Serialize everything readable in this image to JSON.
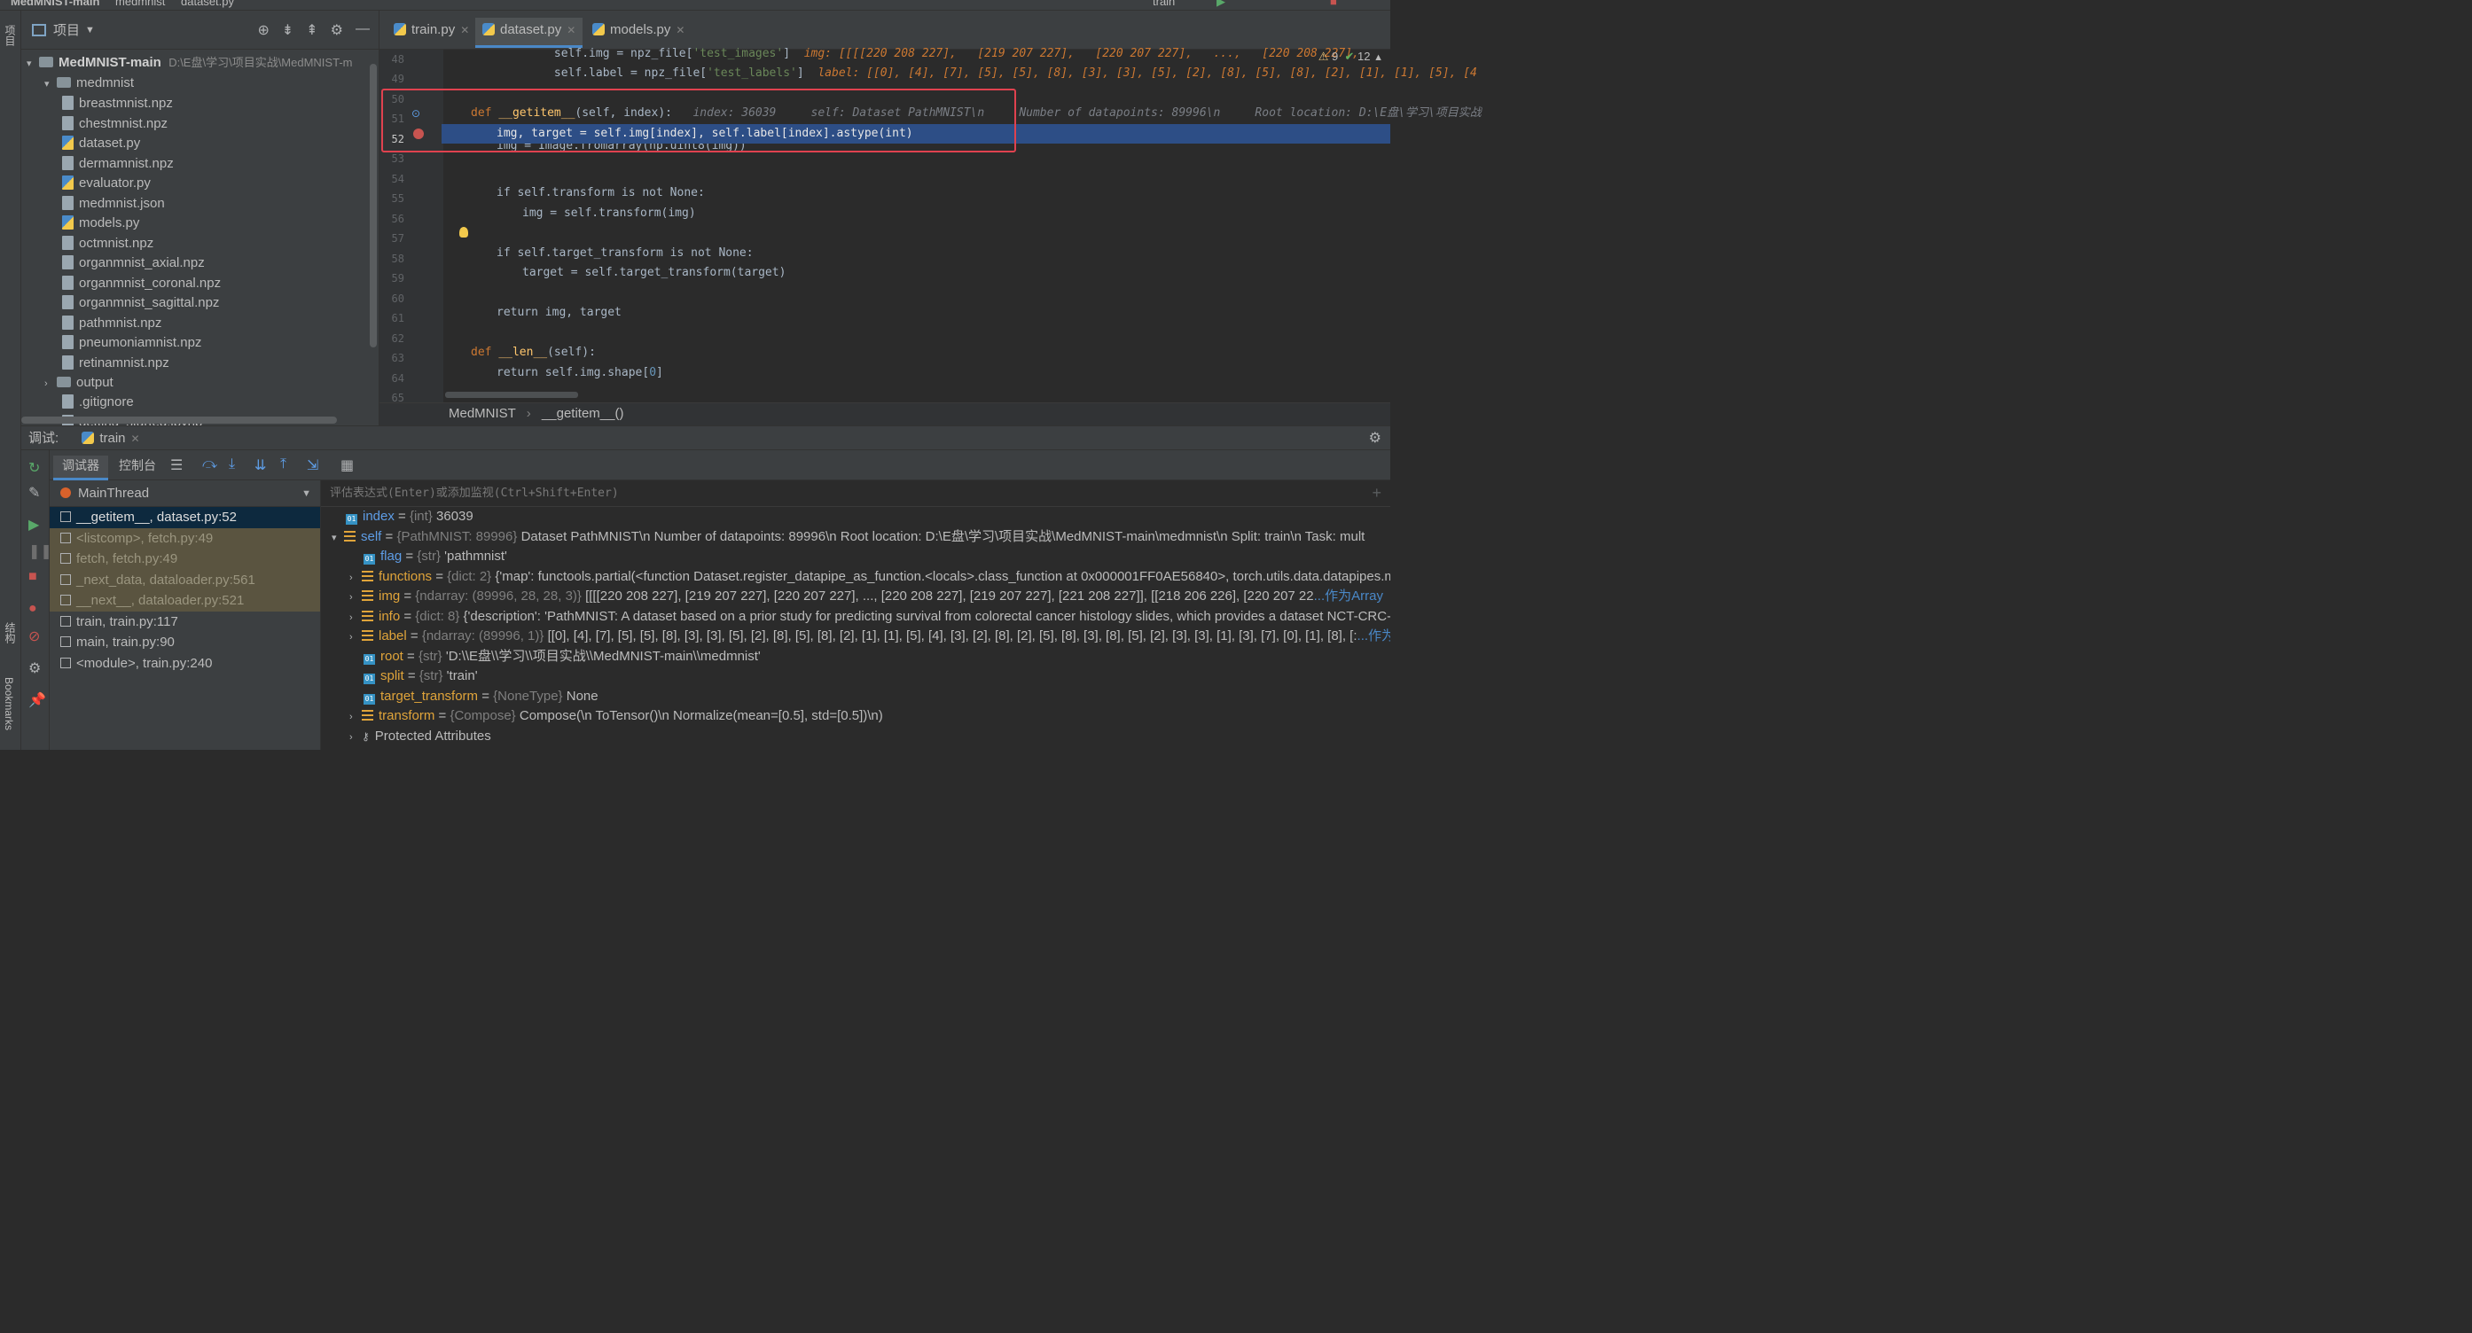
{
  "topbar": {
    "project": "MedMNIST-main",
    "folder": "medmnist",
    "file": "dataset.py",
    "run_config": "train"
  },
  "leftstrip": {
    "project_label": "项目",
    "structure_label": "结构",
    "bookmarks_label": "Bookmarks"
  },
  "project_panel": {
    "title": "项目",
    "root": {
      "name": "MedMNIST-main",
      "path": "D:\\E盘\\学习\\项目实战\\MedMNIST-m"
    },
    "folder": "medmnist",
    "files": [
      "breastmnist.npz",
      "chestmnist.npz",
      "dataset.py",
      "dermamnist.npz",
      "evaluator.py",
      "medmnist.json",
      "models.py",
      "octmnist.npz",
      "organmnist_axial.npz",
      "organmnist_coronal.npz",
      "organmnist_sagittal.npz",
      "pathmnist.npz",
      "pneumoniamnist.npz",
      "retinamnist.npz"
    ],
    "output_folder": "output",
    "root_files": [
      ".gitignore",
      "getting_started.ipynb"
    ]
  },
  "editor": {
    "tabs": [
      {
        "label": "train.py"
      },
      {
        "label": "dataset.py"
      },
      {
        "label": "models.py"
      }
    ],
    "inspections": {
      "warnings": "9",
      "ok": "12"
    },
    "line_numbers": [
      "48",
      "49",
      "50",
      "51",
      "52",
      "53",
      "54",
      "55",
      "56",
      "57",
      "58",
      "59",
      "60",
      "61",
      "62",
      "63",
      "64",
      "65"
    ],
    "code": {
      "l48_pre": "            self.img = npz_file[",
      "l48_str": "'test_images'",
      "l48_post": "]",
      "l48_hint": "img: [[[[220 208 227],   [219 207 227],   [220 207 227],   ...,   [220 208 227],",
      "l49_pre": "            self.label = npz_file[",
      "l49_str": "'test_labels'",
      "l49_post": "]",
      "l49_hint": "label: [[0], [4], [7], [5], [5], [8], [3], [3], [5], [2], [8], [5], [8], [2], [1], [1], [5], [4",
      "l51_def": "def ",
      "l51_name": "__getitem__",
      "l51_args": "(self, index):",
      "l51_hint": "index: 36039     self: Dataset PathMNIST\\n     Number of datapoints: 89996\\n     Root location: D:\\E盘\\学习\\项目实战",
      "l52": "img, target = self.img[index], self.label[index].astype(int)",
      "l53": "img = Image.fromarray(np.uint8(img))",
      "l55": "if self.transform is not None:",
      "l56": "img = self.transform(img)",
      "l58": "if self.target_transform is not None:",
      "l59": "target = self.target_transform(target)",
      "l61": "return img, target",
      "l63_name": "__len__",
      "l63_args": "(self):",
      "l64_pre": "return self.img.shape[",
      "l64_num": "0",
      "l64_post": "]"
    },
    "breadcrumb": {
      "class": "MedMNIST",
      "method": "__getitem__()"
    }
  },
  "debug": {
    "label": "调试:",
    "session": "train",
    "tab_debugger": "调试器",
    "tab_console": "控制台",
    "thread": "MainThread",
    "frames": [
      "__getitem__, dataset.py:52",
      "<listcomp>, fetch.py:49",
      "fetch, fetch.py:49",
      "_next_data, dataloader.py:561",
      "__next__, dataloader.py:521",
      "train, train.py:117",
      "main, train.py:90",
      "<module>, train.py:240"
    ],
    "eval_placeholder": "评估表达式(Enter)或添加监视(Ctrl+Shift+Enter)",
    "vars": {
      "index": {
        "name": "index",
        "type": "{int}",
        "value": "36039"
      },
      "self": {
        "name": "self",
        "type": "{PathMNIST: 89996}",
        "value": "Dataset PathMNIST\\n     Number of datapoints: 89996\\n     Root location: D:\\E盘\\学习\\项目实战\\MedMNIST-main\\medmnist\\n     Split: train\\n     Task: mult"
      },
      "flag": {
        "name": "flag",
        "type": "{str}",
        "value": "'pathmnist'"
      },
      "functions": {
        "name": "functions",
        "type": "{dict: 2}",
        "value": "{'map': functools.partial(<function Dataset.register_datapipe_as_function.<locals>.class_function at 0x000001FF0AE56840>, torch.utils.data.datapipes.map.c"
      },
      "img": {
        "name": "img",
        "type": "{ndarray: (89996, 28, 28, 3)}",
        "value": "[[[[220 208 227],   [219 207 227],   [220 207 227],   ...,   [220 208 227],   [219 207 227],   [221 208 227]],  [[218 206 226],   [220 207 22",
        "more": "...作为Array"
      },
      "info": {
        "name": "info",
        "type": "{dict: 8}",
        "value": "{'description': 'PathMNIST: A dataset based on a prior study for predicting survival from colorectal cancer histology slides, which provides a dataset NCT-CRC-HE-"
      },
      "label": {
        "name": "label",
        "type": "{ndarray: (89996, 1)}",
        "value": "[[0], [4], [7], [5], [5], [8], [3], [3], [5], [2], [8], [5], [8], [2], [1], [1], [5], [4], [3], [2], [8], [2], [5], [8], [3], [8], [5], [2], [3], [3], [1], [3], [7], [0], [1], [8], [:",
        "more": "...作为Array"
      },
      "root": {
        "name": "root",
        "type": "{str}",
        "value": "'D:\\\\E盘\\\\学习\\\\项目实战\\\\MedMNIST-main\\\\medmnist'"
      },
      "split": {
        "name": "split",
        "type": "{str}",
        "value": "'train'"
      },
      "target_transform": {
        "name": "target_transform",
        "type": "{NoneType}",
        "value": "None"
      },
      "transform": {
        "name": "transform",
        "type": "{Compose}",
        "value": "Compose(\\n     ToTensor()\\n     Normalize(mean=[0.5], std=[0.5])\\n)"
      },
      "protected": "Protected Attributes"
    }
  }
}
